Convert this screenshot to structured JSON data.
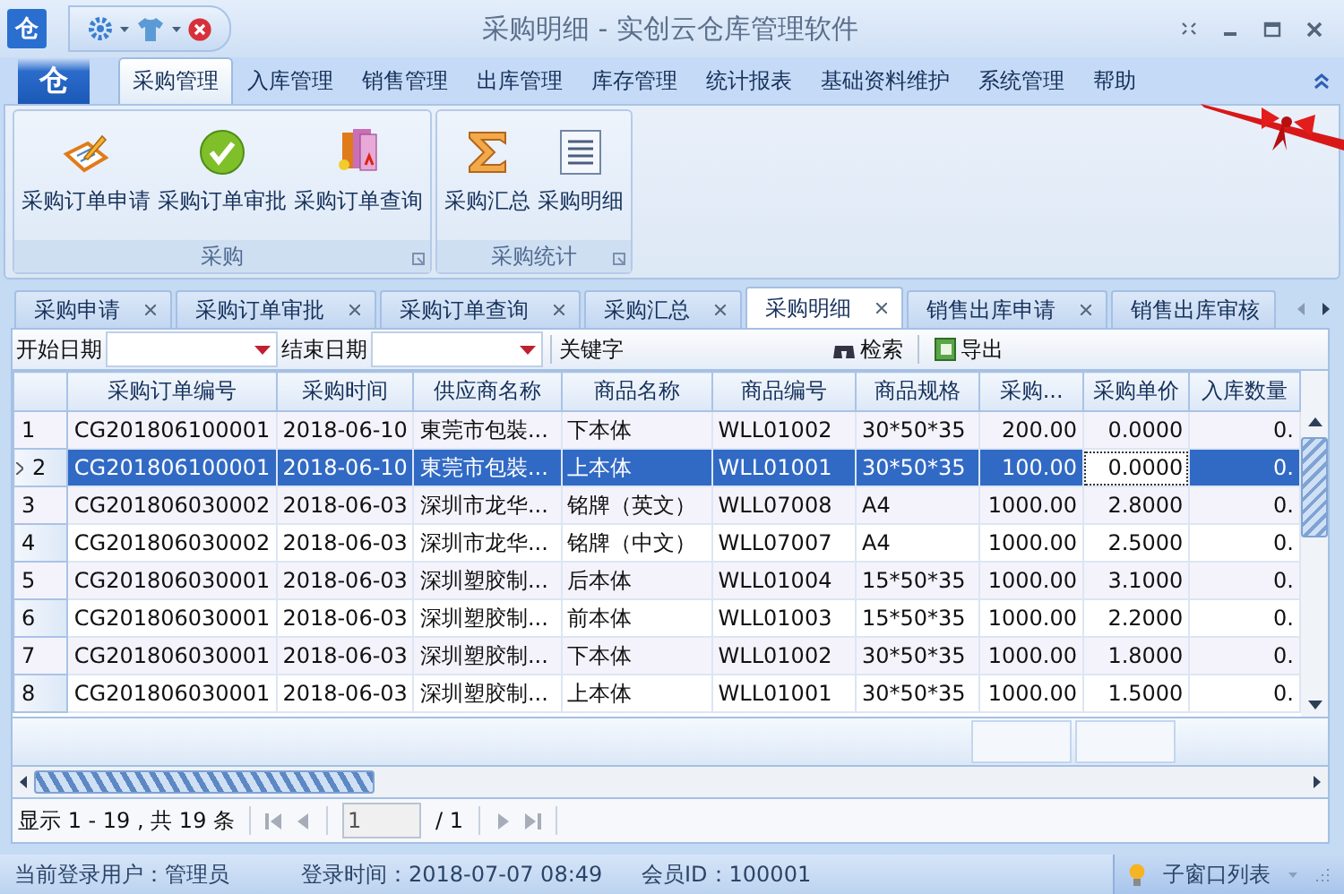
{
  "window": {
    "title": "采购明细 - 实创云仓库管理软件",
    "logo": "仓"
  },
  "ribbon": {
    "app_button": "仓",
    "tabs": [
      {
        "label": "采购管理",
        "selected": true
      },
      {
        "label": "入库管理",
        "selected": false
      },
      {
        "label": "销售管理",
        "selected": false
      },
      {
        "label": "出库管理",
        "selected": false
      },
      {
        "label": "库存管理",
        "selected": false
      },
      {
        "label": "统计报表",
        "selected": false
      },
      {
        "label": "基础资料维护",
        "selected": false
      },
      {
        "label": "系统管理",
        "selected": false
      },
      {
        "label": "帮助",
        "selected": false
      }
    ],
    "groups": [
      {
        "title": "采购",
        "buttons": [
          {
            "label": "采购订单申请",
            "kind": "form"
          },
          {
            "label": "采购订单审批",
            "kind": "check"
          },
          {
            "label": "采购订单查询",
            "kind": "books"
          }
        ]
      },
      {
        "title": "采购统计",
        "buttons": [
          {
            "label": "采购汇总",
            "kind": "sigma"
          },
          {
            "label": "采购明细",
            "kind": "list"
          }
        ]
      }
    ]
  },
  "doc_tabs": [
    {
      "label": "采购申请",
      "selected": false
    },
    {
      "label": "采购订单审批",
      "selected": false
    },
    {
      "label": "采购订单查询",
      "selected": false
    },
    {
      "label": "采购汇总",
      "selected": false
    },
    {
      "label": "采购明细",
      "selected": true
    },
    {
      "label": "销售出库申请",
      "selected": false
    },
    {
      "label": "销售出库审核",
      "selected": false
    }
  ],
  "filter": {
    "start_label": "开始日期",
    "end_label": "结束日期",
    "keyword_label": "关键字",
    "search_button": "检索",
    "export_button": "导出"
  },
  "table": {
    "columns": [
      {
        "label": "采购订单编号",
        "kind": "text",
        "focused": false
      },
      {
        "label": "采购时间",
        "kind": "text",
        "focused": false
      },
      {
        "label": "供应商名称",
        "kind": "text",
        "focused": false
      },
      {
        "label": "商品名称",
        "kind": "text",
        "focused": false
      },
      {
        "label": "商品编号",
        "kind": "text",
        "focused": false
      },
      {
        "label": "商品规格",
        "kind": "text",
        "focused": false
      },
      {
        "label": "采购...",
        "kind": "number",
        "focused": false
      },
      {
        "label": "采购单价",
        "kind": "number",
        "focused": true
      },
      {
        "label": "入库数量",
        "kind": "number",
        "focused": false
      }
    ],
    "rows": [
      {
        "index": "1",
        "selected": false,
        "cells": [
          "CG201806100001",
          "2018-06-10",
          "東莞市包裝...",
          "下本体",
          "WLL01002",
          "30*50*35",
          "200.00",
          "0.0000",
          "0."
        ]
      },
      {
        "index": "2",
        "selected": true,
        "cells": [
          "CG201806100001",
          "2018-06-10",
          "東莞市包裝...",
          "上本体",
          "WLL01001",
          "30*50*35",
          "100.00",
          "0.0000",
          "0."
        ]
      },
      {
        "index": "3",
        "selected": false,
        "cells": [
          "CG201806030002",
          "2018-06-03",
          "深圳市龙华...",
          "铭牌（英文）",
          "WLL07008",
          "A4",
          "1000.00",
          "2.8000",
          "0."
        ]
      },
      {
        "index": "4",
        "selected": false,
        "cells": [
          "CG201806030002",
          "2018-06-03",
          "深圳市龙华...",
          "铭牌（中文）",
          "WLL07007",
          "A4",
          "1000.00",
          "2.5000",
          "0."
        ]
      },
      {
        "index": "5",
        "selected": false,
        "cells": [
          "CG201806030001",
          "2018-06-03",
          "深圳塑胶制...",
          "后本体",
          "WLL01004",
          "15*50*35",
          "1000.00",
          "3.1000",
          "0."
        ]
      },
      {
        "index": "6",
        "selected": false,
        "cells": [
          "CG201806030001",
          "2018-06-03",
          "深圳塑胶制...",
          "前本体",
          "WLL01003",
          "15*50*35",
          "1000.00",
          "2.2000",
          "0."
        ]
      },
      {
        "index": "7",
        "selected": false,
        "cells": [
          "CG201806030001",
          "2018-06-03",
          "深圳塑胶制...",
          "下本体",
          "WLL01002",
          "30*50*35",
          "1000.00",
          "1.8000",
          "0."
        ]
      },
      {
        "index": "8",
        "selected": false,
        "cells": [
          "CG201806030001",
          "2018-06-03",
          "深圳塑胶制...",
          "上本体",
          "WLL01001",
          "30*50*35",
          "1000.00",
          "1.5000",
          "0."
        ]
      }
    ]
  },
  "pager": {
    "summary": "显示 1 - 19 , 共 19 条",
    "page": "1",
    "total": "/ 1"
  },
  "status_bar": {
    "user": "当前登录用户：管理员",
    "login_time": "登录时间：2018-07-07 08:49",
    "member": "会员ID：100001",
    "window_list": "子窗口列表"
  }
}
